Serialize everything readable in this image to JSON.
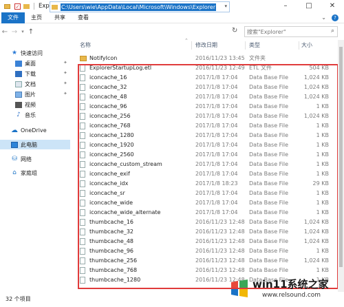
{
  "window": {
    "title": "Explorer"
  },
  "ribbon": {
    "tabs": [
      "文件",
      "主页",
      "共享",
      "查看"
    ]
  },
  "address": {
    "path": "C:\\Users\\wie\\AppData\\Local\\Microsoft\\Windows\\Explorer"
  },
  "search": {
    "placeholder": "搜索\"Explorer\""
  },
  "nav": {
    "quick_access": "快速访问",
    "items": [
      "桌面",
      "下载",
      "文档",
      "图片",
      "视频",
      "音乐"
    ],
    "onedrive": "OneDrive",
    "this_pc": "此电脑",
    "network": "网络",
    "homegroup": "家庭组"
  },
  "columns": {
    "name": "名称",
    "date": "修改日期",
    "type": "类型",
    "size": "大小"
  },
  "files": [
    {
      "name": "NotifyIcon",
      "date": "2016/11/23 13:45",
      "type": "文件夹",
      "size": "",
      "folder": true
    },
    {
      "name": "ExplorerStartupLog.etl",
      "date": "2016/11/23 12:49",
      "type": "ETL 文件",
      "size": "504 KB"
    },
    {
      "name": "iconcache_16",
      "date": "2017/1/8 17:04",
      "type": "Data Base File",
      "size": "1,024 KB"
    },
    {
      "name": "iconcache_32",
      "date": "2017/1/8 17:04",
      "type": "Data Base File",
      "size": "1,024 KB"
    },
    {
      "name": "iconcache_48",
      "date": "2017/1/8 17:04",
      "type": "Data Base File",
      "size": "1,024 KB"
    },
    {
      "name": "iconcache_96",
      "date": "2017/1/8 17:04",
      "type": "Data Base File",
      "size": "1 KB"
    },
    {
      "name": "iconcache_256",
      "date": "2017/1/8 17:04",
      "type": "Data Base File",
      "size": "1,024 KB"
    },
    {
      "name": "iconcache_768",
      "date": "2017/1/8 17:04",
      "type": "Data Base File",
      "size": "1 KB"
    },
    {
      "name": "iconcache_1280",
      "date": "2017/1/8 17:04",
      "type": "Data Base File",
      "size": "1 KB"
    },
    {
      "name": "iconcache_1920",
      "date": "2017/1/8 17:04",
      "type": "Data Base File",
      "size": "1 KB"
    },
    {
      "name": "iconcache_2560",
      "date": "2017/1/8 17:04",
      "type": "Data Base File",
      "size": "1 KB"
    },
    {
      "name": "iconcache_custom_stream",
      "date": "2017/1/8 17:04",
      "type": "Data Base File",
      "size": "1 KB"
    },
    {
      "name": "iconcache_exif",
      "date": "2017/1/8 17:04",
      "type": "Data Base File",
      "size": "1 KB"
    },
    {
      "name": "iconcache_idx",
      "date": "2017/1/8 18:23",
      "type": "Data Base File",
      "size": "29 KB"
    },
    {
      "name": "iconcache_sr",
      "date": "2017/1/8 17:04",
      "type": "Data Base File",
      "size": "1 KB"
    },
    {
      "name": "iconcache_wide",
      "date": "2017/1/8 17:04",
      "type": "Data Base File",
      "size": "1 KB"
    },
    {
      "name": "iconcache_wide_alternate",
      "date": "2017/1/8 17:04",
      "type": "Data Base File",
      "size": "1 KB"
    },
    {
      "name": "thumbcache_16",
      "date": "2016/11/23 12:48",
      "type": "Data Base File",
      "size": "1,024 KB"
    },
    {
      "name": "thumbcache_32",
      "date": "2016/11/23 12:48",
      "type": "Data Base File",
      "size": "1,024 KB"
    },
    {
      "name": "thumbcache_48",
      "date": "2016/11/23 12:48",
      "type": "Data Base File",
      "size": "1,024 KB"
    },
    {
      "name": "thumbcache_96",
      "date": "2016/11/23 12:48",
      "type": "Data Base File",
      "size": "1 KB"
    },
    {
      "name": "thumbcache_256",
      "date": "2016/11/23 12:48",
      "type": "Data Base File",
      "size": "1,024 KB"
    },
    {
      "name": "thumbcache_768",
      "date": "2016/11/23 12:48",
      "type": "Data Base File",
      "size": "1 KB"
    },
    {
      "name": "thumbcache_1280",
      "date": "2016/11/23 12:48",
      "type": "Data Base File",
      "size": "1 KB"
    }
  ],
  "status": {
    "count": "32 个项目"
  },
  "watermark": {
    "name": "win11系统之家",
    "url": "www.relsound.com"
  },
  "colors": {
    "accent": "#1a73c7",
    "highlight_border": "#e03a3a",
    "folder": "#e8b84a"
  }
}
